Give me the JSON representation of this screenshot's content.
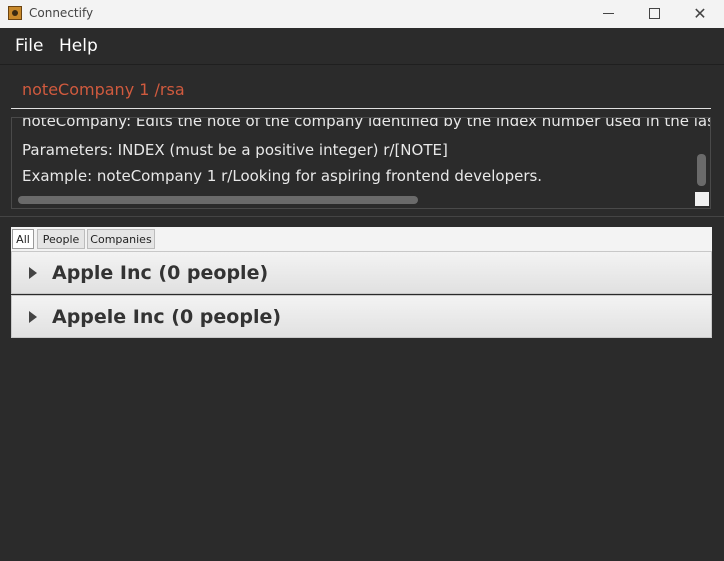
{
  "window": {
    "title": "Connectify",
    "icon": "connectify-app-icon"
  },
  "menu": {
    "file": "File",
    "help": "Help"
  },
  "command": {
    "value": "noteCompany 1 /rsa"
  },
  "result": {
    "lines": [
      "noteCompany: Edits the note of the company identified by the index number used in the last",
      "Parameters: INDEX (must be a positive integer) r/[NOTE]",
      "Example: noteCompany 1 r/Looking for aspiring frontend developers."
    ]
  },
  "tabs": [
    {
      "label": "All",
      "active": true
    },
    {
      "label": "People",
      "active": false
    },
    {
      "label": "Companies",
      "active": false
    }
  ],
  "companies": [
    {
      "label": "Apple Inc (0 people)",
      "icon": "expand-arrow-icon"
    },
    {
      "label": "Appele Inc (0 people)",
      "icon": "expand-arrow-icon"
    }
  ],
  "colors": {
    "background": "#2b2b2b",
    "command_text": "#d05a3e",
    "titlebar": "#f3f3f3"
  }
}
